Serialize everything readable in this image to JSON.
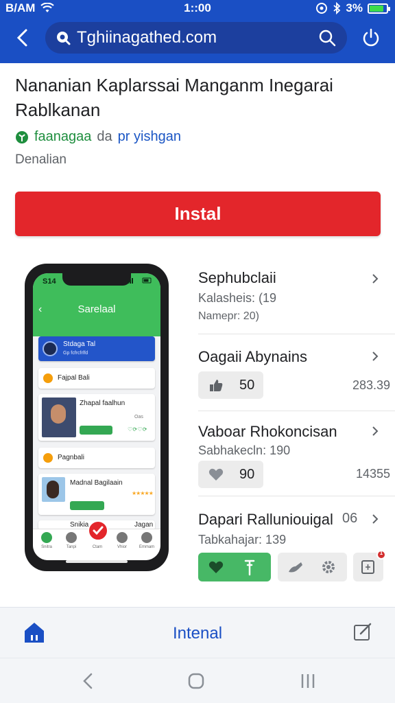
{
  "status_bar": {
    "carrier": "B/AM",
    "time": "1::00",
    "battery": "3%",
    "battery_level": 0.85,
    "icons": [
      "wifi-icon",
      "at-icon",
      "bluetooth-icon",
      "battery-icon"
    ]
  },
  "browser": {
    "url": "Tghiinagathed.com",
    "icons": [
      "back-arrow-icon",
      "lock-icon",
      "search-icon",
      "power-icon"
    ]
  },
  "app": {
    "title": "Nananian Kaplarssai Manganm Inegarai Rablkanan",
    "developer_name": "faanagaa",
    "developer_by": "da",
    "developer_publisher": "pr yishgan",
    "category": "Denalian",
    "install_label": "Instal"
  },
  "phone_screen": {
    "time": "S14",
    "header_title": "Sarelaal",
    "cards": [
      {
        "title": "Stdaga Tal",
        "sub": "Gp fcfrcfrlfd"
      },
      {
        "title": "Fajpal Bali"
      },
      {
        "title": "Zhapal faalhun",
        "meta": "Oas"
      },
      {
        "title": "Pagnbali"
      },
      {
        "title": "Madnal Bagilaain"
      },
      {
        "title": "Snikia",
        "meta": "Jagan"
      }
    ],
    "tabs": [
      "Snitra",
      "Tanpi",
      "Ctam",
      "Vhior",
      "Emmam"
    ]
  },
  "right_list": [
    {
      "title": "Sephubclaii",
      "meta": "Kalasheis: (19",
      "meta2": "Namepr: 20)"
    },
    {
      "title": "Oagaii Abynains",
      "chip_value": "50",
      "stat": "283.39"
    },
    {
      "title": "Vaboar Rhokoncisan",
      "meta": "Sabhakecln: 190",
      "chip_value": "90",
      "stat": "14355"
    },
    {
      "title": "Dapari Ralluniouigal",
      "title_suffix": "06",
      "meta": "Tabkahajar: 139"
    }
  ],
  "action_buttons": [
    "heart-icon",
    "pin-icon",
    "bird-icon",
    "gear-icon",
    "note-icon"
  ],
  "notification_count": "1",
  "bottom_nav": {
    "label": "Intenal",
    "icons": [
      "home-icon",
      "edit-icon"
    ]
  },
  "system_nav": [
    "back-icon",
    "home-circle-icon",
    "recents-icon"
  ],
  "colors": {
    "brand_blue": "#1a4fc4",
    "install_red": "#e3262b",
    "green": "#47b866"
  }
}
